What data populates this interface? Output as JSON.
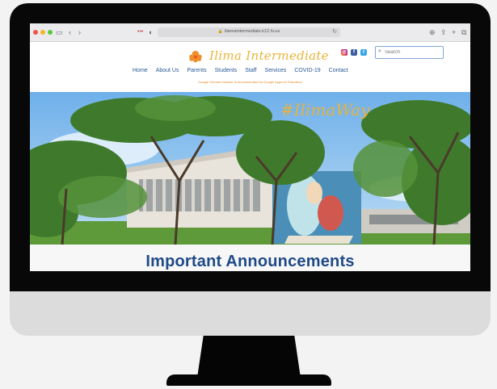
{
  "browser": {
    "url": "iliamaintermediate.k12.hi.us",
    "icons": {
      "sidebar": "sidebar-icon",
      "back": "chevron-left-icon",
      "forward": "chevron-right-icon",
      "share": "share-icon",
      "add_tab": "plus-icon",
      "tabs": "tabs-icon",
      "download": "download-icon",
      "shield": "shield-icon",
      "lock": "lock-icon",
      "reload": "reload-icon"
    }
  },
  "site": {
    "logo_text": "Ilima Intermediate",
    "nav": [
      "Home",
      "About Us",
      "Parents",
      "Students",
      "Staff",
      "Services",
      "COVID-19",
      "Contact"
    ],
    "search_placeholder": "Search",
    "notice": "Google Chrome browser is recommended for Google Apps for Education",
    "hero_tag": "#IlimaWay",
    "announcement_title": "Important Announcements",
    "social": [
      "instagram-icon",
      "facebook-icon",
      "twitter-icon"
    ]
  },
  "colors": {
    "brand_gold": "#e9b43c",
    "nav_blue": "#2a5a96",
    "heading_blue": "#1f4a87",
    "notice_orange": "#e08a2b"
  }
}
